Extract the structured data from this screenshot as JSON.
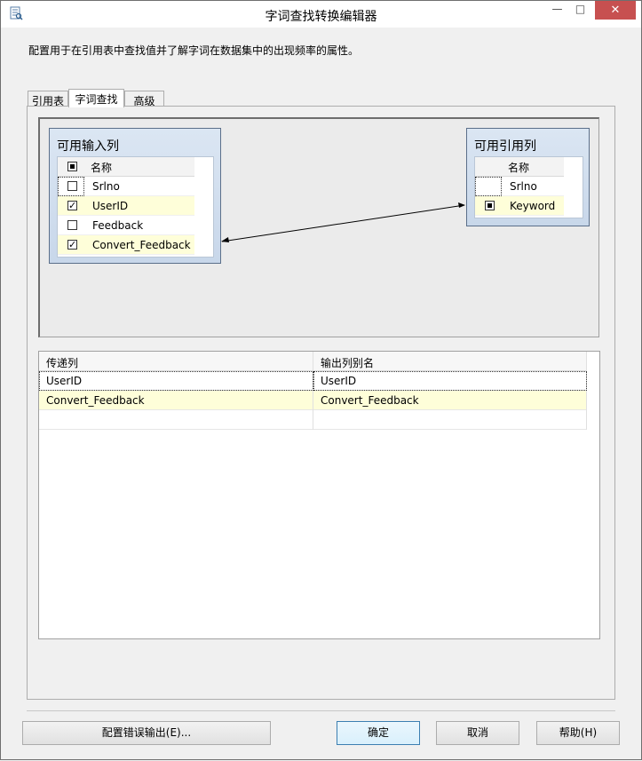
{
  "window": {
    "title": "字词查找转换编辑器",
    "icon": "editor-app-icon",
    "controls": {
      "minimize": "—",
      "maximize": "□",
      "close": "✕"
    }
  },
  "description": "配置用于在引用表中查找值并了解字词在数据集中的出现频率的属性。",
  "tabs": [
    {
      "label": "引用表",
      "active": false
    },
    {
      "label": "字词查找",
      "active": true
    },
    {
      "label": "高级",
      "active": false
    }
  ],
  "input_columns": {
    "title": "可用输入列",
    "header": "名称",
    "rows": [
      {
        "name": "Srlno",
        "checked": false
      },
      {
        "name": "UserID",
        "checked": true
      },
      {
        "name": "Feedback",
        "checked": false
      },
      {
        "name": "Convert_Feedback",
        "checked": true
      }
    ]
  },
  "reference_columns": {
    "title": "可用引用列",
    "header": "名称",
    "rows": [
      {
        "name": "Srlno",
        "checked": false
      },
      {
        "name": "Keyword",
        "checked": true
      }
    ]
  },
  "passthrough_grid": {
    "headers": [
      "传递列",
      "输出列别名"
    ],
    "rows": [
      [
        "UserID",
        "UserID"
      ],
      [
        "Convert_Feedback",
        "Convert_Feedback"
      ]
    ]
  },
  "buttons": {
    "config_error": "配置错误输出(E)...",
    "ok": "确定",
    "cancel": "取消",
    "help": "帮助(H)"
  },
  "colors": {
    "highlight_row": "#fefed9",
    "box_gradient_top": "#dbe6f3",
    "close_button": "#c75050"
  }
}
